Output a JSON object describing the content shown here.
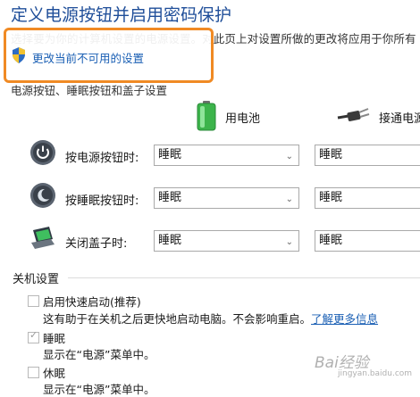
{
  "window": {
    "title": "定义电源按钮并启用密码保护",
    "intro_text": "选择要为你的计算机设置的电源设置。对此页上对设置所做的更改将应用于你所有",
    "change_link": "更改当前不可用的设置"
  },
  "power_settings": {
    "section_label": "电源按钮、睡眠按钮和盖子设置",
    "battery_label": "用电池",
    "ac_label": "接通电源",
    "rows": [
      {
        "label": "按电源按钮时:",
        "battery_value": "睡眠",
        "ac_value": "睡眠"
      },
      {
        "label": "按睡眠按钮时:",
        "battery_value": "睡眠",
        "ac_value": "睡眠"
      },
      {
        "label": "关闭盖子时:",
        "battery_value": "睡眠",
        "ac_value": "睡眠"
      }
    ]
  },
  "shutdown": {
    "section_label": "关机设置",
    "options": [
      {
        "label": "启用快速启动(推荐)",
        "desc": "这有助于在关机之后更快地启动电脑。不会影响重启。",
        "link": "了解更多信息",
        "checked": false
      },
      {
        "label": "睡眠",
        "desc": "显示在“电源”菜单中。",
        "checked": true
      },
      {
        "label": "休眠",
        "desc": "显示在“电源”菜单中。",
        "checked": false
      }
    ]
  },
  "watermark": {
    "text": "Bai经验",
    "sub": "jingyan.baidu.com"
  },
  "colors": {
    "accent": "#1a5fb4",
    "highlight": "#f08a24",
    "battery": "#3cb44b"
  }
}
